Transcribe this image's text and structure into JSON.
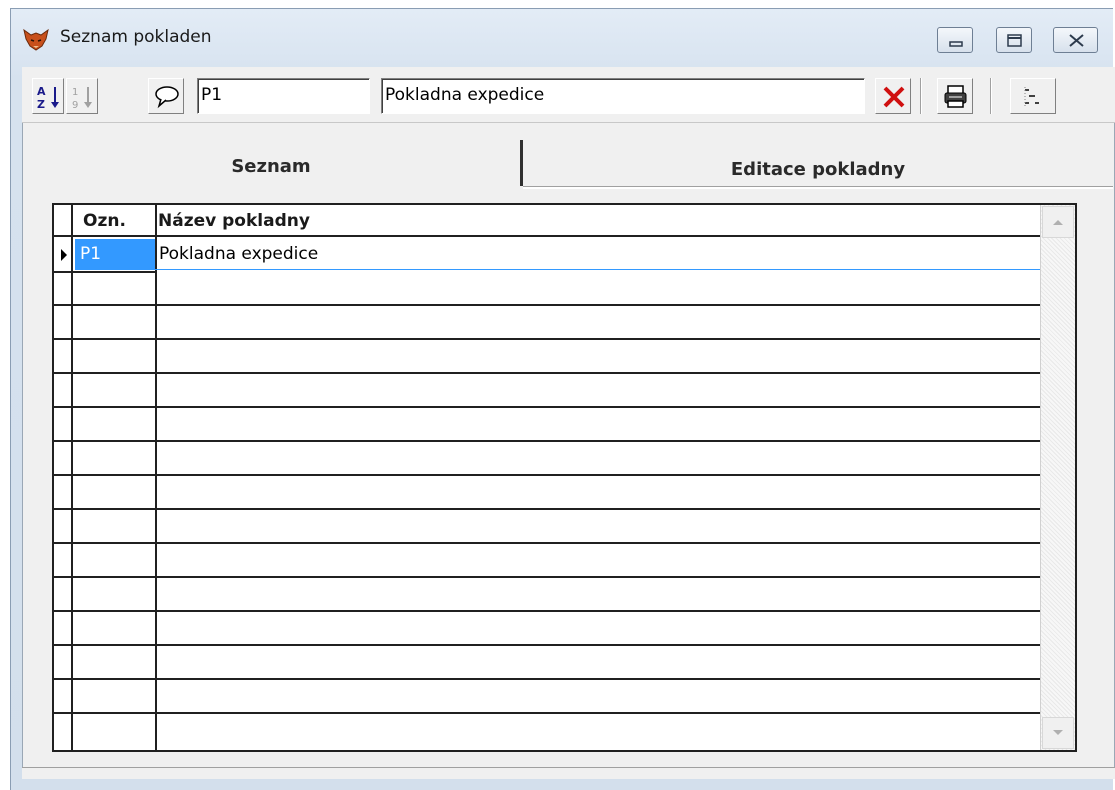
{
  "window": {
    "title": "Seznam pokladen"
  },
  "toolbar": {
    "sort_az_icon": "sort-az-icon",
    "sort_num_icon": "sort-numeric-icon",
    "comment_icon": "comment-bubble-icon",
    "code_value": "P1",
    "name_value": "Pokladna expedice",
    "delete_icon": "delete-x-icon",
    "print_icon": "printer-icon",
    "tree_icon": "tree-list-icon"
  },
  "tabs": [
    {
      "label": "Seznam",
      "active": true
    },
    {
      "label": "Editace pokladny",
      "active": false
    }
  ],
  "grid": {
    "columns": [
      "Ozn.",
      "Název pokladny"
    ],
    "rows": [
      {
        "code": "P1",
        "name": "Pokladna expedice",
        "selected": true
      }
    ]
  },
  "colors": {
    "selection": "#3399ff",
    "delete": "#d01010"
  }
}
